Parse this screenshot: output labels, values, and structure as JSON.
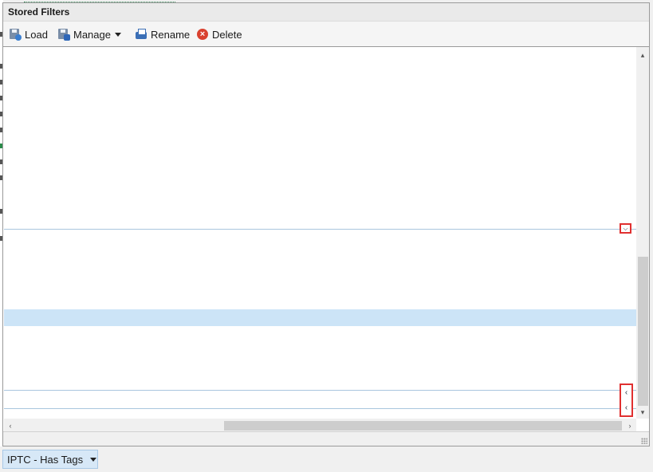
{
  "dialog": {
    "title": "Stored Filters"
  },
  "toolbar": {
    "load_label": "Load",
    "manage_label": "Manage",
    "rename_label": "Rename",
    "delete_label": "Delete"
  },
  "icons": {
    "load": "load-disk-icon",
    "manage": "manage-disk-icon",
    "rename": "rename-printer-icon",
    "delete": "delete-x-icon",
    "expander_down": "chevron-down-icon",
    "expander_left": "chevron-left-icon"
  },
  "colors": {
    "selection": "#cce4f7",
    "separator": "#a9c6de",
    "highlight_border": "#e03030",
    "filter_dropdown_bg": "#d7e8f7"
  },
  "filter_dropdown": {
    "label": "IPTC - Has Tags"
  }
}
